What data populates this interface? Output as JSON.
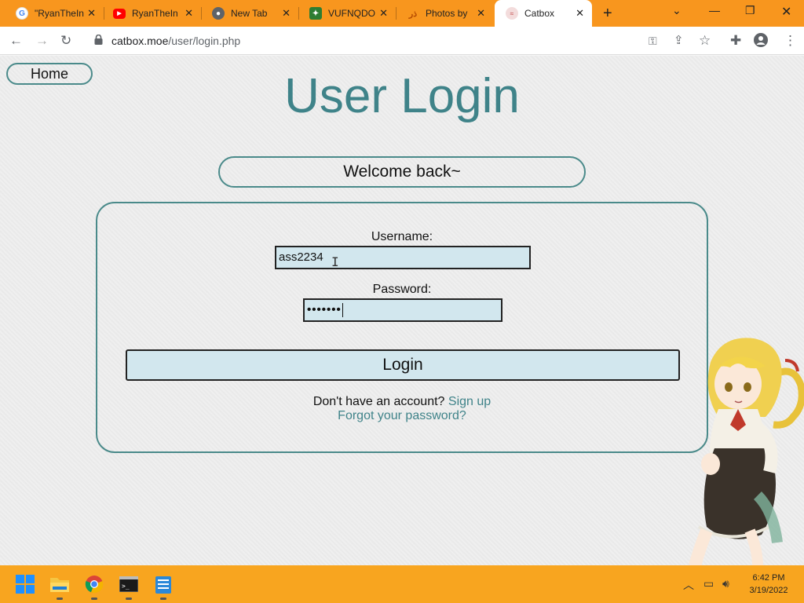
{
  "browser": {
    "tabs": [
      {
        "label": "\"RyanTheIn",
        "icon": "google-icon",
        "color": "#4285f4"
      },
      {
        "label": "RyanTheIn",
        "icon": "youtube-icon",
        "color": "#ff0000"
      },
      {
        "label": "New Tab",
        "icon": "chrome-icon",
        "color": "#5f6368"
      },
      {
        "label": "VUFNQDO",
        "icon": "tenor-icon",
        "color": "#2e7d32"
      },
      {
        "label": "Photos by",
        "icon": "photos-icon",
        "color": "#e06d10"
      },
      {
        "label": "Catbox",
        "icon": "catbox-icon",
        "color": "#e8b4b4",
        "active": true
      }
    ],
    "url_domain": "catbox.moe",
    "url_path": "/user/login.php"
  },
  "page": {
    "home_label": "Home",
    "title": "User Login",
    "welcome": "Welcome back~",
    "username_label": "Username:",
    "username_value": "ass2234",
    "password_label": "Password:",
    "password_value": "•••••••",
    "login_label": "Login",
    "no_account_text": "Don't have an account?",
    "signup_link": "Sign up",
    "forgot_link": "Forgot your password?"
  },
  "taskbar": {
    "apps": [
      "windows-start-icon",
      "file-explorer-icon",
      "chrome-icon",
      "terminal-icon",
      "notepad-icon"
    ],
    "time": "6:42 PM",
    "date": "3/19/2022"
  },
  "colors": {
    "accent": "#3f8389",
    "field_bg": "#d2e7ee",
    "tabstrip": "#f8961e",
    "taskbar": "#f8a51f"
  }
}
